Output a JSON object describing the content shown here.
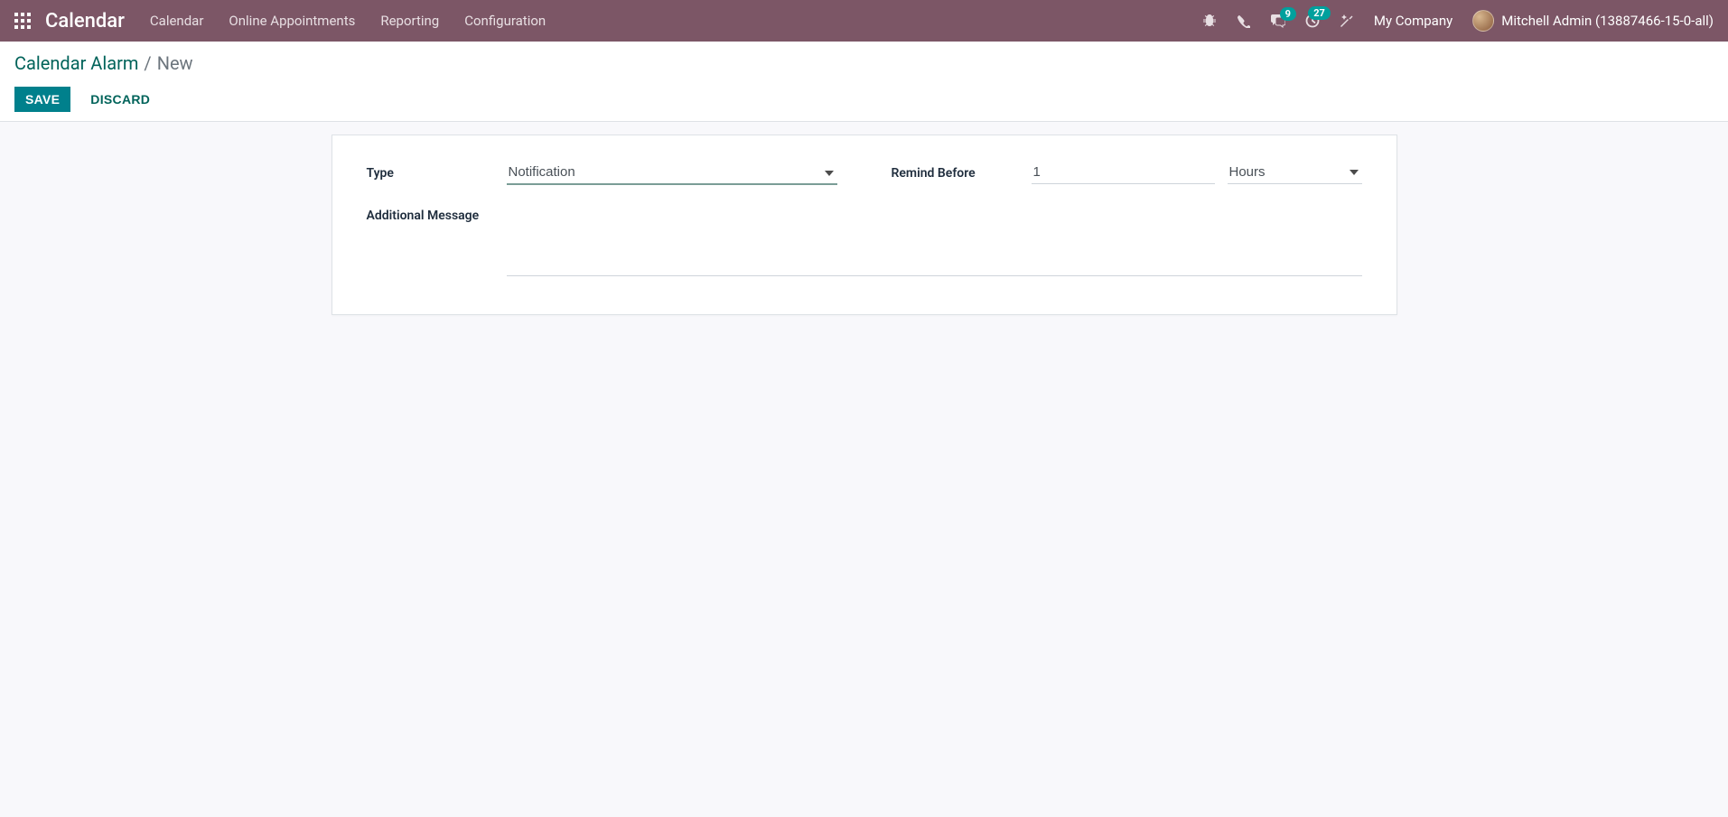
{
  "navbar": {
    "brand": "Calendar",
    "menu": [
      "Calendar",
      "Online Appointments",
      "Reporting",
      "Configuration"
    ],
    "chat_badge": "9",
    "activity_badge": "27",
    "company": "My Company",
    "user": "Mitchell Admin (13887466-15-0-all)"
  },
  "breadcrumb": {
    "parent": "Calendar Alarm",
    "current": "New"
  },
  "buttons": {
    "save": "SAVE",
    "discard": "DISCARD"
  },
  "form": {
    "type_label": "Type",
    "type_value": "Notification",
    "remind_label": "Remind Before",
    "remind_value": "1",
    "remind_unit": "Hours",
    "additional_label": "Additional Message",
    "additional_value": ""
  }
}
